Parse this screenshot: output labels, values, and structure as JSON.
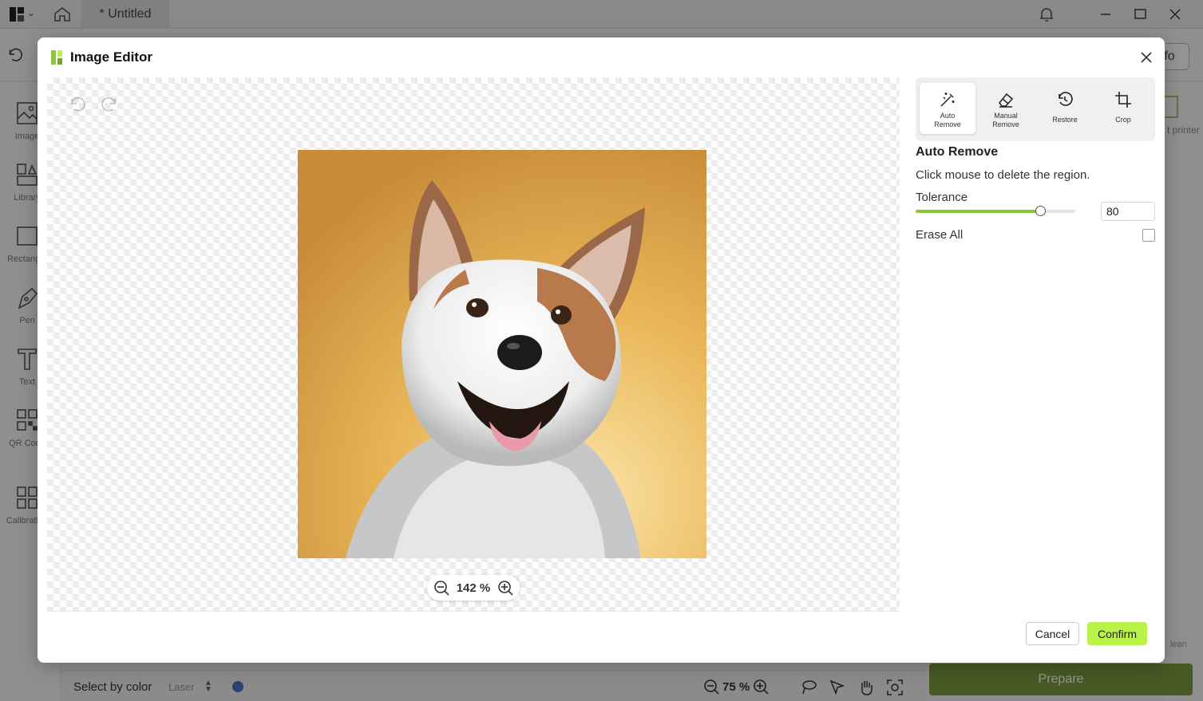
{
  "app": {
    "tab_title": "* Untitled",
    "info_label": "Info",
    "printer_label": "t printer",
    "select_by_color": "Select by color",
    "laser_label": "Laser",
    "zoom_level": "75 %",
    "prepare_label": "Prepare",
    "clean_label": "lean",
    "sidebar": [
      {
        "label": "Image",
        "icon": "image-icon"
      },
      {
        "label": "Library",
        "icon": "library-icon"
      },
      {
        "label": "Rectangle",
        "icon": "rectangle-icon"
      },
      {
        "label": "Pen",
        "icon": "pen-icon"
      },
      {
        "label": "Text",
        "icon": "text-icon"
      },
      {
        "label": "QR Code",
        "icon": "qr-code-icon"
      },
      {
        "label": "Calibration",
        "icon": "calibration-icon"
      }
    ],
    "accent": "#7a9a3e",
    "color_dot": "#4a73c9"
  },
  "modal": {
    "title": "Image Editor",
    "zoom_level": "142 %",
    "tools": [
      {
        "label_lines": [
          "Auto",
          "Remove"
        ],
        "icon": "magic-wand-icon",
        "active": true
      },
      {
        "label_lines": [
          "Manual",
          "Remove"
        ],
        "icon": "eraser-icon",
        "active": false
      },
      {
        "label_lines": [
          "Restore"
        ],
        "icon": "restore-history-icon",
        "active": false
      },
      {
        "label_lines": [
          "Crop"
        ],
        "icon": "crop-icon",
        "active": false
      }
    ],
    "section_title": "Auto Remove",
    "section_desc": "Click mouse to delete the region.",
    "tolerance_label": "Tolerance",
    "tolerance_value": "80",
    "tolerance_fraction": 0.78,
    "erase_all_label": "Erase All",
    "erase_all_checked": false,
    "cancel_label": "Cancel",
    "confirm_label": "Confirm",
    "confirm_color": "#b8f24a",
    "slider_color": "#8dc43c"
  }
}
